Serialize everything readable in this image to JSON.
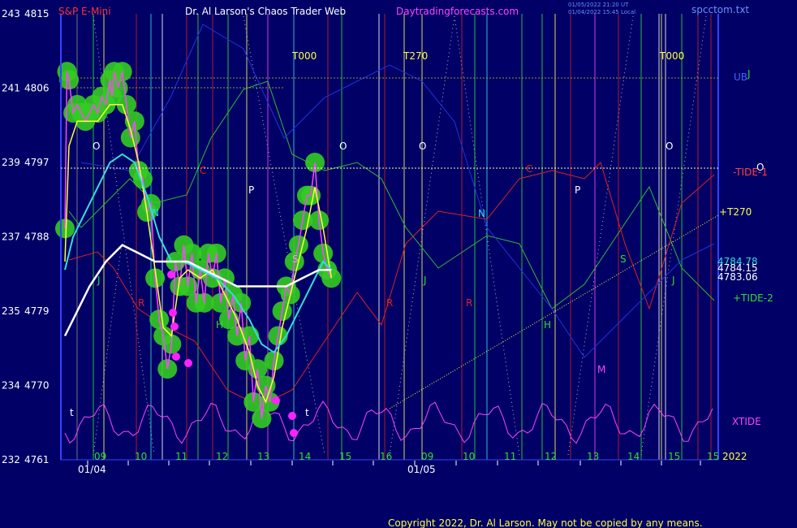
{
  "header": {
    "symbol": "S&P E-Mini",
    "title": "Dr. Al Larson's Chaos Trader Web",
    "site": "Daytradingforecasts.com",
    "file": "spcctom.txt",
    "time1": "01/05/2022 21:20 UT",
    "time2": "01/04/2022 15:45 Local",
    "copyright": "Copyright 2022, Dr. Al Larson. May not be copied by any means.",
    "colors": {
      "symbol": "#ff3333",
      "title": "#ffffff",
      "site": "#ff44ff",
      "file": "#6f8fff"
    }
  },
  "chart_data": {
    "type": "line",
    "y_range": [
      4761,
      4815
    ],
    "x_range_hours": [
      8.5,
      16.85
    ],
    "y_ticks": [
      {
        "left": "243",
        "right": "4815",
        "value": 4815
      },
      {
        "left": "241",
        "right": "4806",
        "value": 4806
      },
      {
        "left": "239",
        "right": "4797",
        "value": 4797
      },
      {
        "left": "237",
        "right": "4788",
        "value": 4788
      },
      {
        "left": "235",
        "right": "4779",
        "value": 4779
      },
      {
        "left": "234",
        "right": "4770",
        "value": 4770
      },
      {
        "left": "232",
        "right": "4761",
        "value": 4761
      }
    ],
    "x_ticks": [
      {
        "label": "09",
        "t": 9.0
      },
      {
        "label": "10",
        "t": 10.0
      },
      {
        "label": "11",
        "t": 11.0
      },
      {
        "label": "12",
        "t": 12.0
      },
      {
        "label": "13",
        "t": 13.0
      },
      {
        "label": "14",
        "t": 14.0
      },
      {
        "label": "15",
        "t": 15.0
      },
      {
        "label": "16",
        "t": 16.0
      },
      {
        "label": "09",
        "t": 9.0,
        "day": 2
      },
      {
        "label": "10",
        "t": 10.0,
        "day": 2
      },
      {
        "label": "11",
        "t": 11.0,
        "day": 2
      },
      {
        "label": "12",
        "t": 12.0,
        "day": 2
      },
      {
        "label": "13",
        "t": 13.0,
        "day": 2
      },
      {
        "label": "14",
        "t": 14.0,
        "day": 2
      },
      {
        "label": "15",
        "t": 15.0,
        "day": 2
      },
      {
        "label": "15",
        "t": 15.9,
        "day": 2
      }
    ],
    "date_labels": [
      "01/04",
      "01/05"
    ],
    "year_label": "2022",
    "right_labels": {
      "ub": "UB",
      "tide1": "-TIDE-1",
      "t270": "+T270",
      "tide2": "+TIDE-2",
      "xtide": "XTIDE",
      "price1": "4784.78",
      "price2": "4784.15",
      "price3": "4783.06"
    },
    "top_labels": [
      "T000",
      "T270",
      "T000"
    ],
    "letter_labels": [
      "O",
      "O",
      "O",
      "O",
      "N",
      "N",
      "P",
      "P",
      "S",
      "S",
      "J",
      "J",
      "J",
      "R",
      "R",
      "R",
      "H",
      "H",
      "M",
      "C",
      "C",
      "t",
      "t",
      "J",
      "O"
    ],
    "series": [
      {
        "name": "",
        "kind": "price",
        "color": "#ff44ff",
        "points": [
          [
            8.5,
            4789
          ],
          [
            8.55,
            4808
          ],
          [
            8.6,
            4807
          ],
          [
            8.7,
            4803
          ],
          [
            8.8,
            4804
          ],
          [
            8.9,
            4803
          ],
          [
            9.0,
            4802
          ],
          [
            9.1,
            4803
          ],
          [
            9.2,
            4804
          ],
          [
            9.3,
            4803
          ],
          [
            9.4,
            4805
          ],
          [
            9.5,
            4804
          ],
          [
            9.6,
            4807
          ],
          [
            9.65,
            4805
          ],
          [
            9.7,
            4808
          ],
          [
            9.8,
            4806
          ],
          [
            9.9,
            4808
          ],
          [
            10.0,
            4804
          ],
          [
            10.1,
            4800
          ],
          [
            10.2,
            4802
          ],
          [
            10.3,
            4796
          ],
          [
            10.4,
            4795
          ],
          [
            10.5,
            4791
          ],
          [
            10.6,
            4792
          ],
          [
            10.7,
            4783
          ],
          [
            10.8,
            4778
          ],
          [
            10.9,
            4776
          ],
          [
            11.0,
            4772
          ],
          [
            11.1,
            4775
          ],
          [
            11.2,
            4785
          ],
          [
            11.3,
            4782
          ],
          [
            11.4,
            4787
          ],
          [
            11.5,
            4782
          ],
          [
            11.6,
            4786
          ],
          [
            11.7,
            4780
          ],
          [
            11.8,
            4784
          ],
          [
            11.9,
            4780
          ],
          [
            12.0,
            4786
          ],
          [
            12.1,
            4783
          ],
          [
            12.2,
            4786
          ],
          [
            12.3,
            4780
          ],
          [
            12.4,
            4783
          ],
          [
            12.5,
            4778
          ],
          [
            12.6,
            4781
          ],
          [
            12.7,
            4776
          ],
          [
            12.8,
            4780
          ],
          [
            12.9,
            4773
          ],
          [
            13.0,
            4776
          ],
          [
            13.1,
            4768
          ],
          [
            13.2,
            4772
          ],
          [
            13.3,
            4766
          ],
          [
            13.4,
            4770
          ],
          [
            13.5,
            4768
          ],
          [
            13.6,
            4773
          ],
          [
            13.7,
            4776
          ],
          [
            13.8,
            4779
          ],
          [
            13.9,
            4782
          ],
          [
            14.0,
            4781
          ],
          [
            14.1,
            4785
          ],
          [
            14.2,
            4787
          ],
          [
            14.3,
            4790
          ],
          [
            14.4,
            4793
          ],
          [
            14.5,
            4793
          ],
          [
            14.6,
            4797
          ],
          [
            14.7,
            4790
          ],
          [
            14.8,
            4786
          ],
          [
            14.9,
            4784
          ],
          [
            15.0,
            4783
          ]
        ]
      },
      {
        "name": "",
        "kind": "fast_avg",
        "color": "#ffff33",
        "points": [
          [
            8.5,
            4785
          ],
          [
            8.6,
            4799
          ],
          [
            8.8,
            4802
          ],
          [
            9.0,
            4802
          ],
          [
            9.3,
            4802
          ],
          [
            9.6,
            4804
          ],
          [
            9.9,
            4804
          ],
          [
            10.1,
            4801
          ],
          [
            10.3,
            4797
          ],
          [
            10.5,
            4791
          ],
          [
            10.7,
            4784
          ],
          [
            10.9,
            4777
          ],
          [
            11.1,
            4776
          ],
          [
            11.3,
            4783
          ],
          [
            11.5,
            4784
          ],
          [
            11.8,
            4783
          ],
          [
            12.1,
            4784
          ],
          [
            12.4,
            4781
          ],
          [
            12.7,
            4778
          ],
          [
            13.0,
            4774
          ],
          [
            13.2,
            4770
          ],
          [
            13.4,
            4768
          ],
          [
            13.6,
            4771
          ],
          [
            13.8,
            4777
          ],
          [
            14.0,
            4781
          ],
          [
            14.2,
            4785
          ],
          [
            14.4,
            4789
          ],
          [
            14.6,
            4794
          ],
          [
            14.8,
            4789
          ],
          [
            15.0,
            4783
          ]
        ]
      },
      {
        "name": "",
        "kind": "slow_avg",
        "color": "#33dddd",
        "points": [
          [
            8.5,
            4784
          ],
          [
            8.7,
            4788
          ],
          [
            9.0,
            4791
          ],
          [
            9.3,
            4794
          ],
          [
            9.6,
            4797
          ],
          [
            9.9,
            4798
          ],
          [
            10.2,
            4797
          ],
          [
            10.5,
            4793
          ],
          [
            10.8,
            4788
          ],
          [
            11.1,
            4785
          ],
          [
            11.4,
            4785
          ],
          [
            11.8,
            4784
          ],
          [
            12.2,
            4783
          ],
          [
            12.6,
            4781
          ],
          [
            13.0,
            4778
          ],
          [
            13.3,
            4775
          ],
          [
            13.6,
            4774
          ],
          [
            13.9,
            4776
          ],
          [
            14.2,
            4779
          ],
          [
            14.5,
            4782
          ],
          [
            14.8,
            4785
          ],
          [
            15.0,
            4784
          ]
        ]
      },
      {
        "name": "",
        "kind": "long_avg",
        "color": "#ffffff",
        "points": [
          [
            8.5,
            4776
          ],
          [
            8.8,
            4779
          ],
          [
            9.1,
            4782
          ],
          [
            9.5,
            4785
          ],
          [
            9.9,
            4787
          ],
          [
            10.3,
            4786
          ],
          [
            10.7,
            4785
          ],
          [
            11.1,
            4785
          ],
          [
            11.5,
            4785
          ],
          [
            11.9,
            4784
          ],
          [
            12.3,
            4783
          ],
          [
            12.7,
            4782
          ],
          [
            13.1,
            4782
          ],
          [
            13.5,
            4782
          ],
          [
            13.9,
            4782
          ],
          [
            14.3,
            4783
          ],
          [
            14.7,
            4784
          ],
          [
            15.0,
            4784
          ]
        ]
      }
    ],
    "grid": "dotted",
    "legend": "right-edge labels"
  }
}
